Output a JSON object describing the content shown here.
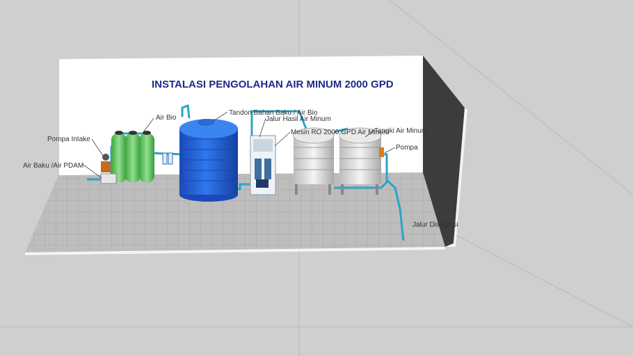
{
  "title": "INSTALASI PENGOLAHAN AIR MINUM 2000 GPD",
  "labels": {
    "air_bio_filter": "Air Bio",
    "pompa_intake": "Pompa Intake",
    "air_baku": "Air Baku /Air PDAM",
    "tandon": "Tandon Bahan Baku / Air Bio",
    "jalur_hasil": "Jalur Hasil Air Minum",
    "mesin_ro": "Mesin RO 2000 GPD Air Minum",
    "tangki": "Tangki Air Minum",
    "pompa": "Pompa",
    "jalur_distribusi": "Jalur Distribusi"
  },
  "colors": {
    "background": "#cfcfcf",
    "floor": "#b9b9b9",
    "wall": "#ffffff",
    "side_wall": "#3c3c3c",
    "pipe": "#2aa4c8",
    "tank_blue": "#1e5fd9",
    "filter_green": "#6fcf6f",
    "title": "#1d2a8c"
  }
}
